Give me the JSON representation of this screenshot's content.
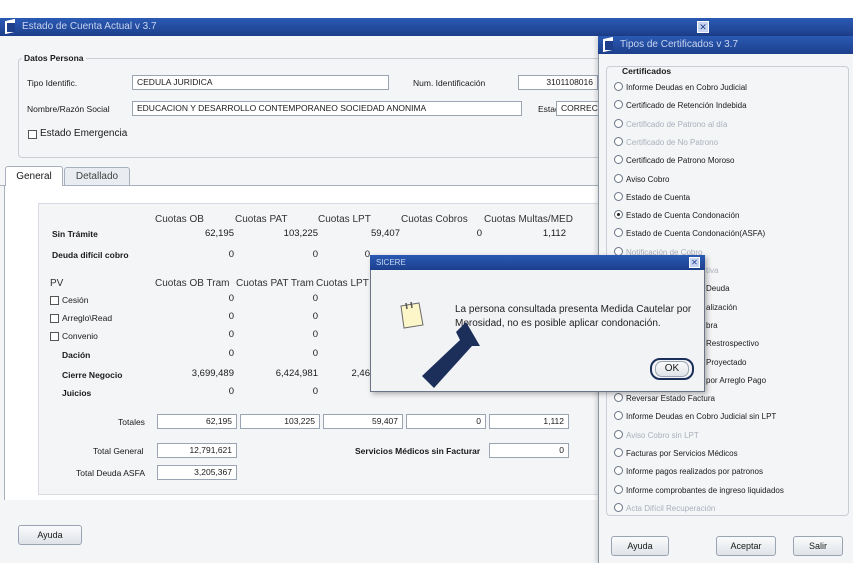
{
  "main_window": {
    "title": "Estado de Cuenta Actual v 3.7",
    "close_glyph": "✕",
    "datos_persona": {
      "group_label": "Datos Persona",
      "tipo_label": "Tipo Identific.",
      "tipo_value": "CEDULA JURIDICA",
      "num_label": "Num. Identificación",
      "num_value": "3101108016",
      "nombre_label": "Nombre/Razón Social",
      "nombre_value": "EDUCACION Y DESARROLLO CONTEMPORANEO SOCIEDAD ANONIMA",
      "estado_label": "Estado",
      "estado_value": "CORRECT",
      "emergencia_label": "Estado Emergencia"
    },
    "tabs": [
      "General",
      "Detallado"
    ],
    "top_table": {
      "headers": [
        "Cuotas OB",
        "Cuotas PAT",
        "Cuotas LPT",
        "Cuotas Cobros",
        "Cuotas Multas/MED"
      ],
      "rows": [
        {
          "label": "Sin Trámite",
          "values": [
            "62,195",
            "103,225",
            "59,407",
            "0",
            "1,112"
          ]
        },
        {
          "label": "Deuda difícil cobro",
          "values": [
            "0",
            "0",
            "0",
            "",
            ""
          ]
        }
      ]
    },
    "pv_table": {
      "pv_label": "PV",
      "headers": [
        "Cuotas OB Tram",
        "Cuotas PAT Tram",
        "Cuotas LPT"
      ],
      "rows": [
        {
          "label": "Cesión",
          "checkbox": true,
          "values": [
            "0",
            "0"
          ]
        },
        {
          "label": "Arreglo\\Read",
          "checkbox": true,
          "values": [
            "0",
            "0"
          ]
        },
        {
          "label": "Convenio",
          "checkbox": true,
          "values": [
            "0",
            "0"
          ]
        },
        {
          "label": "Dación",
          "checkbox": false,
          "values": [
            "0",
            "0"
          ]
        },
        {
          "label": "Cierre Negocio",
          "checkbox": false,
          "values": [
            "3,699,489",
            "6,424,981",
            "2,46"
          ]
        },
        {
          "label": "Juicios",
          "checkbox": false,
          "values": [
            "0",
            "0"
          ]
        }
      ]
    },
    "totales": {
      "label": "Totales",
      "values": [
        "62,195",
        "103,225",
        "59,407",
        "0",
        "1,112"
      ]
    },
    "total_general": {
      "label": "Total General",
      "value": "12,791,621"
    },
    "servicios": {
      "label": "Servicios Médicos sin Facturar",
      "value": "0"
    },
    "total_asfa": {
      "label": "Total Deuda ASFA",
      "value": "3,205,367"
    },
    "ayuda_button": "Ayuda"
  },
  "cert_window": {
    "title": "Tipos de Certificados v 3.7",
    "group_label": "Certificados",
    "options": [
      {
        "label": "Informe Deudas en Cobro Judicial",
        "selected": false,
        "enabled": true
      },
      {
        "label": "Certificado de Retención Indebida",
        "selected": false,
        "enabled": true
      },
      {
        "label": "Certificado de Patrono al día",
        "selected": false,
        "enabled": false
      },
      {
        "label": "Certificado de No Patrono",
        "selected": false,
        "enabled": false
      },
      {
        "label": "Certificado de Patrono Moroso",
        "selected": false,
        "enabled": true
      },
      {
        "label": "Aviso Cobro",
        "selected": false,
        "enabled": true
      },
      {
        "label": "Estado de Cuenta",
        "selected": false,
        "enabled": true
      },
      {
        "label": "Estado de Cuenta Condonación",
        "selected": true,
        "enabled": true
      },
      {
        "label": "Estado de Cuenta Condonación(ASFA)",
        "selected": false,
        "enabled": true
      },
      {
        "label": "Notificación de Cobro",
        "selected": false,
        "enabled": false
      },
      {
        "label": "tiva",
        "selected": false,
        "enabled": false
      },
      {
        "label": "Deuda",
        "selected": false,
        "enabled": true
      },
      {
        "label": "alización",
        "selected": false,
        "enabled": true
      },
      {
        "label": "bra",
        "selected": false,
        "enabled": true
      },
      {
        "label": "Restrospectivo",
        "selected": false,
        "enabled": true
      },
      {
        "label": "Proyectado",
        "selected": false,
        "enabled": true
      },
      {
        "label": "por Arreglo Pago",
        "selected": false,
        "enabled": true
      },
      {
        "label": "Reversar Estado Factura",
        "selected": false,
        "enabled": true
      },
      {
        "label": "Informe Deudas en Cobro Judicial sin LPT",
        "selected": false,
        "enabled": true
      },
      {
        "label": "Aviso Cobro sin LPT",
        "selected": false,
        "enabled": false
      },
      {
        "label": "Facturas por Servicios Médicos",
        "selected": false,
        "enabled": true
      },
      {
        "label": "Informe pagos realizados por patronos",
        "selected": false,
        "enabled": true
      },
      {
        "label": "Informe comprobantes de ingreso liquidados",
        "selected": false,
        "enabled": true
      },
      {
        "label": "Acta Difícil Recuperación",
        "selected": false,
        "enabled": false
      }
    ],
    "buttons": {
      "ayuda": "Ayuda",
      "aceptar": "Aceptar",
      "salir": "Salir"
    }
  },
  "alert": {
    "title": "SICERE",
    "message": "La persona consultada presenta Medida Cautelar por Morosidad, no es posible aplicar condonación.",
    "ok": "OK",
    "close_glyph": "✕"
  },
  "colors": {
    "titlebar": "#1d3f8c",
    "arrow": "#1c2f5a",
    "ok_ring": "#1c2f5a"
  }
}
